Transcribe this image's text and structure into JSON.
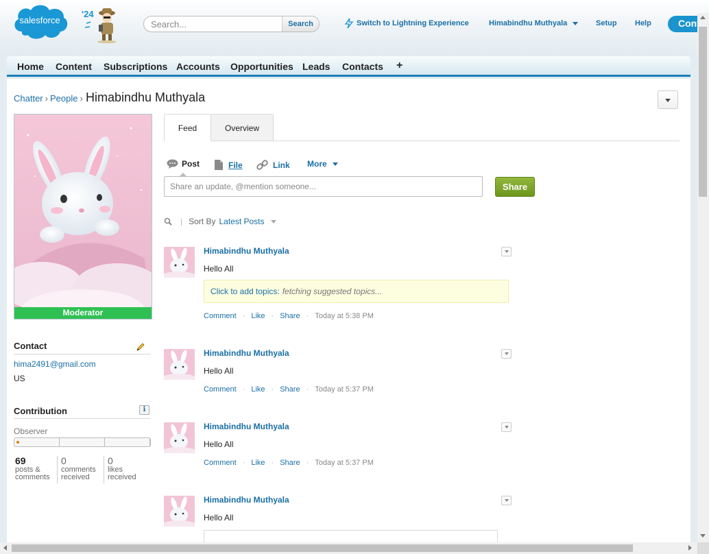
{
  "header": {
    "logo_text": "salesforce",
    "release_badge": "'24",
    "search_placeholder": "Search...",
    "search_button": "Search",
    "lightning_link": "Switch to Lightning Experience",
    "user_name": "Himabindhu Muthyala",
    "setup": "Setup",
    "help": "Help",
    "cut_button": "Cont"
  },
  "nav": {
    "tabs": [
      "Home",
      "Content",
      "Subscriptions",
      "Accounts",
      "Opportunities",
      "Leads",
      "Contacts"
    ],
    "add_tab": "+"
  },
  "breadcrumb": {
    "chatter": "Chatter",
    "people": "People",
    "sep": "›"
  },
  "page_title": "Himabindhu Muthyala",
  "profile": {
    "badge": "Moderator",
    "contact_title": "Contact",
    "email": "hima2491@gmail.com",
    "country": "US",
    "contribution_title": "Contribution",
    "info_glyph": "i",
    "level": "Observer",
    "level_progress": 0.02,
    "stats": [
      {
        "num": "69",
        "label1": "posts &",
        "label2": "comments"
      },
      {
        "num": "0",
        "label1": "comments",
        "label2": "received"
      },
      {
        "num": "0",
        "label1": "likes",
        "label2": "received"
      }
    ]
  },
  "feed_tabs": {
    "feed": "Feed",
    "overview": "Overview"
  },
  "publisher": {
    "post": "Post",
    "file": "File",
    "link": "Link",
    "more": "More",
    "placeholder": "Share an update, @mention someone...",
    "share": "Share"
  },
  "sort": {
    "label": "Sort By",
    "value": "Latest Posts"
  },
  "posts": [
    {
      "author": "Himabindhu Muthyala",
      "text": "Hello All",
      "time": "Today at 5:38 PM",
      "topics_cta": "Click to add topics:",
      "topics_status": "fetching suggested topics..."
    },
    {
      "author": "Himabindhu Muthyala",
      "text": "Hello All",
      "time": "Today at 5:37 PM"
    },
    {
      "author": "Himabindhu Muthyala",
      "text": "Hello All",
      "time": "Today at 5:37 PM"
    },
    {
      "author": "Himabindhu Muthyala",
      "text": "Hello All"
    }
  ],
  "post_actions": {
    "comment": "Comment",
    "like": "Like",
    "share": "Share",
    "dot": "·"
  },
  "colors": {
    "link": "#1a6fa6",
    "brand": "#1a93cf",
    "moderator": "#2fc053",
    "share_button": "#7aa52a"
  }
}
